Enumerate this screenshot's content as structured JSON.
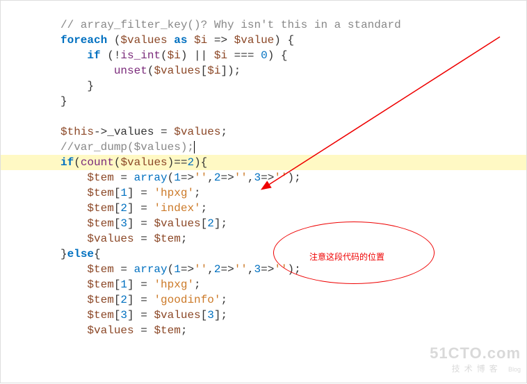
{
  "code": {
    "l1_cmt": "// array_filter_key()? Why isn't this in a standard",
    "l2_foreach": "foreach",
    "l2_var_values": "$values",
    "l2_as": "as",
    "l2_var_i": "$i",
    "l2_var_value": "$value",
    "l3_if": "if",
    "l3_fn_isint": "is_int",
    "l3_var_i": "$i",
    "l3_var_i2": "$i",
    "l3_zero": "0",
    "l4_fn_unset": "unset",
    "l4_var_values": "$values",
    "l4_var_i": "$i",
    "l8_var_this": "$this",
    "l8_prop_values": "_values",
    "l8_var_values": "$values",
    "l9_cmt": "//var_dump($values);",
    "l10_if": "if",
    "l10_fn_count": "count",
    "l10_var_values": "$values",
    "l10_two": "2",
    "l11_var_tem": "$tem",
    "l11_kw_array": "array",
    "l11_one": "1",
    "l11_s1": "''",
    "l11_two": "2",
    "l11_s2": "''",
    "l11_three": "3",
    "l11_s3": "''",
    "l12_var_tem": "$tem",
    "l12_idx": "1",
    "l12_str": "'hpxg'",
    "l13_var_tem": "$tem",
    "l13_idx": "2",
    "l13_str": "'index'",
    "l14_var_tem": "$tem",
    "l14_idx": "3",
    "l14_var_values": "$values",
    "l14_vidx": "2",
    "l15_var_values": "$values",
    "l15_var_tem": "$tem",
    "l16_else": "else",
    "l17_var_tem": "$tem",
    "l17_kw_array": "array",
    "l17_one": "1",
    "l17_s1": "''",
    "l17_two": "2",
    "l17_s2": "''",
    "l17_three": "3",
    "l17_s3": "''",
    "l18_var_tem": "$tem",
    "l18_idx": "1",
    "l18_str": "'hpxg'",
    "l19_var_tem": "$tem",
    "l19_idx": "2",
    "l19_str": "'goodinfo'",
    "l20_var_tem": "$tem",
    "l20_idx": "3",
    "l20_var_values": "$values",
    "l20_vidx": "3",
    "l21_var_values": "$values",
    "l21_var_tem": "$tem"
  },
  "annotation": {
    "label": "注意这段代码的位置"
  },
  "watermark": {
    "site": "51CTO.com",
    "sub": "技术博客",
    "blog": "Blog"
  }
}
